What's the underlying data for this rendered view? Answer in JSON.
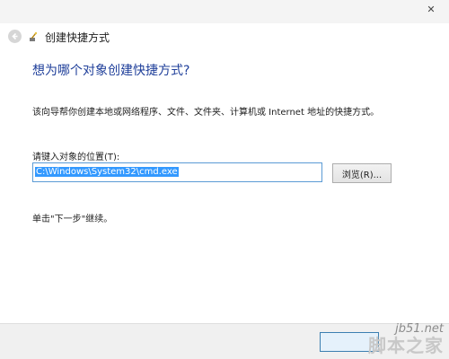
{
  "window": {
    "close_glyph": "✕"
  },
  "nav": {
    "title": "创建快捷方式",
    "back_icon": "back-arrow-icon",
    "wizard_icon": "shortcut-wizard-icon"
  },
  "main": {
    "heading": "想为哪个对象创建快捷方式?",
    "description": "该向导帮你创建本地或网络程序、文件、文件夹、计算机或 Internet 地址的快捷方式。",
    "location_label": "请键入对象的位置(T):",
    "location_value": "C:\\Windows\\System32\\cmd.exe",
    "browse_label": "浏览(R)...",
    "hint": "单击\"下一步\"继续。"
  },
  "watermark": {
    "site": "jb51.net",
    "name": "脚本之家"
  },
  "colors": {
    "heading": "#1f3f9a",
    "input_border": "#5b9bd5",
    "selection": "#3399ff"
  }
}
